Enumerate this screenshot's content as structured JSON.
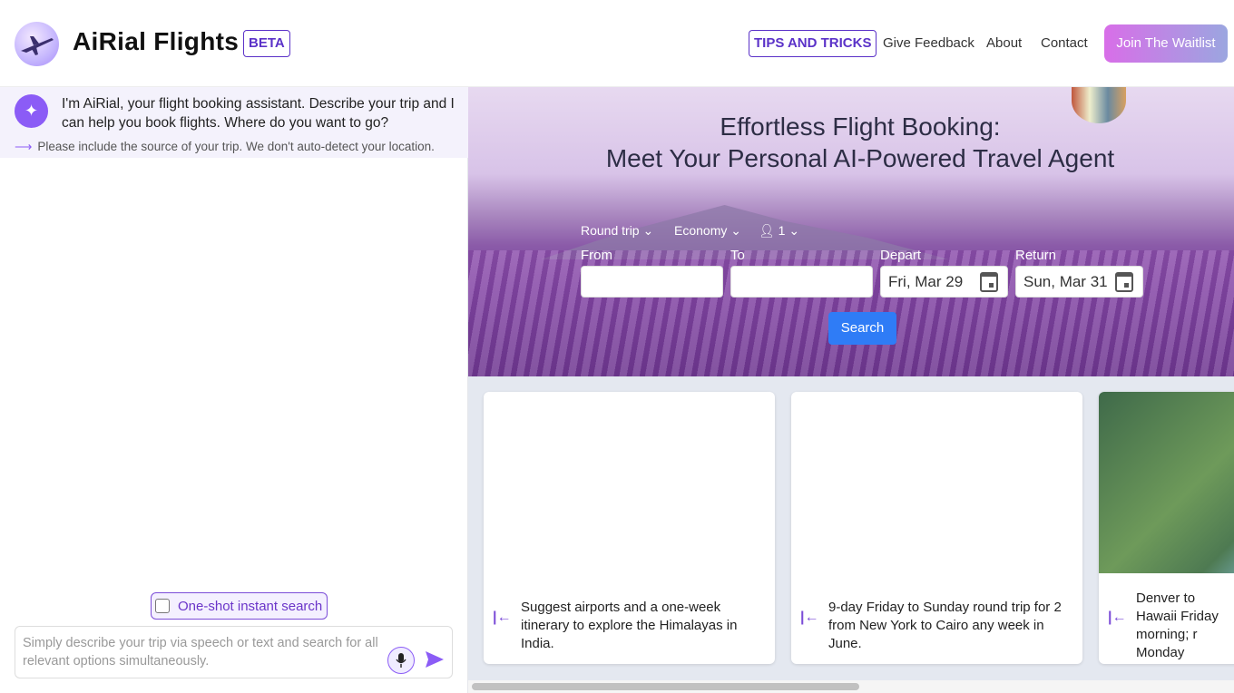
{
  "header": {
    "brand": "AiRial Flights",
    "beta_badge": "BETA",
    "nav": {
      "tips": "TIPS AND TRICKS",
      "feedback": "Give Feedback",
      "about": "About",
      "contact": "Contact",
      "join": "Join The Waitlist"
    }
  },
  "chat": {
    "intro": "I'm AiRial, your flight booking assistant. Describe your trip and I can help you book flights. Where do you want to go?",
    "hint": "Please include the source of your trip. We don't auto-detect your location.",
    "oneshot_label": "One-shot instant search",
    "input_placeholder": "Simply describe your trip via speech or text and search for all relevant options simultaneously."
  },
  "hero": {
    "title_line1": "Effortless Flight Booking:",
    "title_line2": "Meet Your Personal AI-Powered Travel Agent",
    "trip_type": "Round trip",
    "cabin_class": "Economy",
    "passengers": "1",
    "labels": {
      "from": "From",
      "to": "To",
      "depart": "Depart",
      "return": "Return"
    },
    "from_value": "",
    "to_value": "",
    "depart_value": "Fri, Mar 29",
    "return_value": "Sun, Mar 31",
    "search_label": "Search"
  },
  "suggestions": [
    {
      "text": "Suggest airports and a one-week itinerary to explore the Himalayas in India."
    },
    {
      "text": "9-day Friday to Sunday round trip for 2 from New York to Cairo any week in June."
    },
    {
      "text": "Denver to Hawaii Friday morning; r Monday morning"
    }
  ]
}
